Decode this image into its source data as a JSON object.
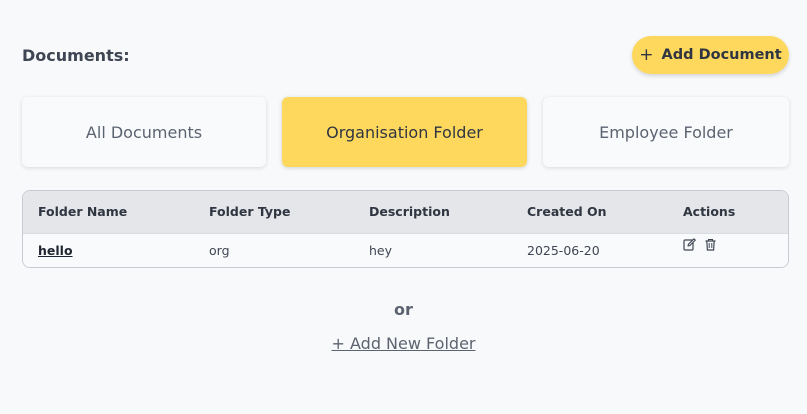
{
  "header": {
    "title": "Documents:",
    "add_document_label": "Add Document",
    "add_document_icon": "+"
  },
  "tabs": [
    {
      "label": "All Documents",
      "active": false
    },
    {
      "label": "Organisation Folder",
      "active": true
    },
    {
      "label": "Employee Folder",
      "active": false
    }
  ],
  "table": {
    "columns": [
      "Folder Name",
      "Folder Type",
      "Description",
      "Created On",
      "Actions"
    ],
    "rows": [
      {
        "folder_name": "hello",
        "folder_type": "org",
        "description": "hey",
        "created_on": "2025-06-20",
        "actions": [
          "edit-icon",
          "trash-icon"
        ]
      }
    ]
  },
  "footer": {
    "or_text": "or",
    "add_folder_label": "+ Add New Folder"
  },
  "colors": {
    "accent": "#fdd85d",
    "background": "#f8f9fb",
    "header_row": "#e5e6e9"
  }
}
